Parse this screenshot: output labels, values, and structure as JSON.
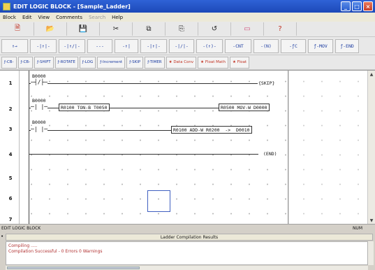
{
  "window": {
    "title": "EDIT LOGIC BLOCK - [Sample_Ladder]"
  },
  "menu": [
    "Block",
    "Edit",
    "View",
    "Comments",
    "Search",
    "Help"
  ],
  "toolbar1": [
    {
      "icon": "new-file-icon",
      "glyph": "🗎",
      "tone": "ico-red"
    },
    {
      "icon": "open-folder-icon",
      "glyph": "📂",
      "tone": "ico-dark"
    },
    {
      "icon": "save-disk-icon",
      "glyph": "💾",
      "tone": "ico-dark"
    },
    {
      "icon": "cut-icon",
      "glyph": "✂",
      "tone": "ico-dark"
    },
    {
      "icon": "copy-icon",
      "glyph": "⧉",
      "tone": "ico-dark"
    },
    {
      "icon": "paste-icon",
      "glyph": "⎘",
      "tone": "ico-dark"
    },
    {
      "icon": "undo-icon",
      "glyph": "↺",
      "tone": "ico-dark"
    },
    {
      "icon": "delete-icon",
      "glyph": "▭",
      "tone": "ico-pink"
    },
    {
      "icon": "help-icon",
      "glyph": "?",
      "tone": "ico-red"
    }
  ],
  "toolbar2": [
    {
      "label": "↑→",
      "w": 38
    },
    {
      "label": "-|↑|-",
      "w": 38
    },
    {
      "label": "-|↑/|-",
      "w": 38
    },
    {
      "label": "---",
      "w": 36
    },
    {
      "label": "-↑|",
      "w": 34
    },
    {
      "label": "-|↑|-",
      "w": 38
    },
    {
      "label": "-|/|-",
      "w": 36
    },
    {
      "label": "-(↑)-",
      "w": 38
    },
    {
      "label": "-CNT",
      "w": 38
    },
    {
      "label": "-(N)",
      "w": 36
    },
    {
      "label": "-ƒC",
      "w": 36
    },
    {
      "label": "ƒ-MOV",
      "w": 36
    },
    {
      "label": "ƒ-END",
      "w": 34
    }
  ],
  "toolbar3": [
    {
      "label": "ƒ-CB-",
      "red": false
    },
    {
      "label": "ƒ-CB-",
      "red": false
    },
    {
      "label": "ƒ-SHIFT",
      "red": false
    },
    {
      "label": "ƒ-ROTATE",
      "red": false
    },
    {
      "label": "ƒ-LOG",
      "red": false
    },
    {
      "label": "ƒ-Increment",
      "red": false
    },
    {
      "label": "ƒ-SKIP",
      "red": false
    },
    {
      "label": "ƒ-TIMER",
      "red": false
    },
    {
      "label": "★ Data Conv",
      "red": true
    },
    {
      "label": "★ Float Math",
      "red": true
    },
    {
      "label": "★ Float",
      "red": true
    }
  ],
  "ladder": {
    "rows": [
      "1",
      "2",
      "3",
      "4",
      "5",
      "6",
      "7"
    ],
    "rung1": {
      "address": "B0000",
      "contact": "─┤/├─",
      "coil": "{SKIP}"
    },
    "rung2": {
      "address": "B0000",
      "contact": "─| |─",
      "timer": "R0100 TON-B T0050",
      "output": "R0500 MOV-W D0000"
    },
    "rung3": {
      "address": "B0000",
      "contact": "─| |─",
      "output": "R0100 ADD-W R0200  ->  D0010"
    },
    "rung4": {
      "coil": "(END)"
    }
  },
  "status": {
    "left": "EDIT LOGIC BLOCK",
    "right": "NUM"
  },
  "results": {
    "header": "Ladder Compilation Results",
    "lines": [
      "Compiling .....",
      "Compilation Successful - 0 Errors 0 Warnings"
    ]
  }
}
